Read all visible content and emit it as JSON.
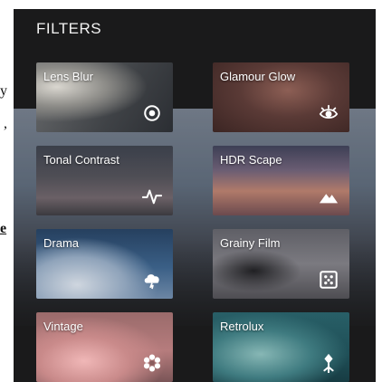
{
  "page_fragments": {
    "frag_1": "y",
    "frag_2": ",",
    "frag_3": "e"
  },
  "header": {
    "title": "FILTERS"
  },
  "filters": [
    {
      "label": "Lens Blur",
      "icon": "target-icon"
    },
    {
      "label": "Glamour Glow",
      "icon": "eye-icon"
    },
    {
      "label": "Tonal Contrast",
      "icon": "pulse-icon"
    },
    {
      "label": "HDR Scape",
      "icon": "mountain-icon"
    },
    {
      "label": "Drama",
      "icon": "cloud-lightning-icon"
    },
    {
      "label": "Grainy Film",
      "icon": "film-grain-icon"
    },
    {
      "label": "Vintage",
      "icon": "flower-icon"
    },
    {
      "label": "Retrolux",
      "icon": "retro-star-icon"
    }
  ],
  "colors": {
    "background": "#1a1a1b",
    "text": "#ffffff"
  }
}
